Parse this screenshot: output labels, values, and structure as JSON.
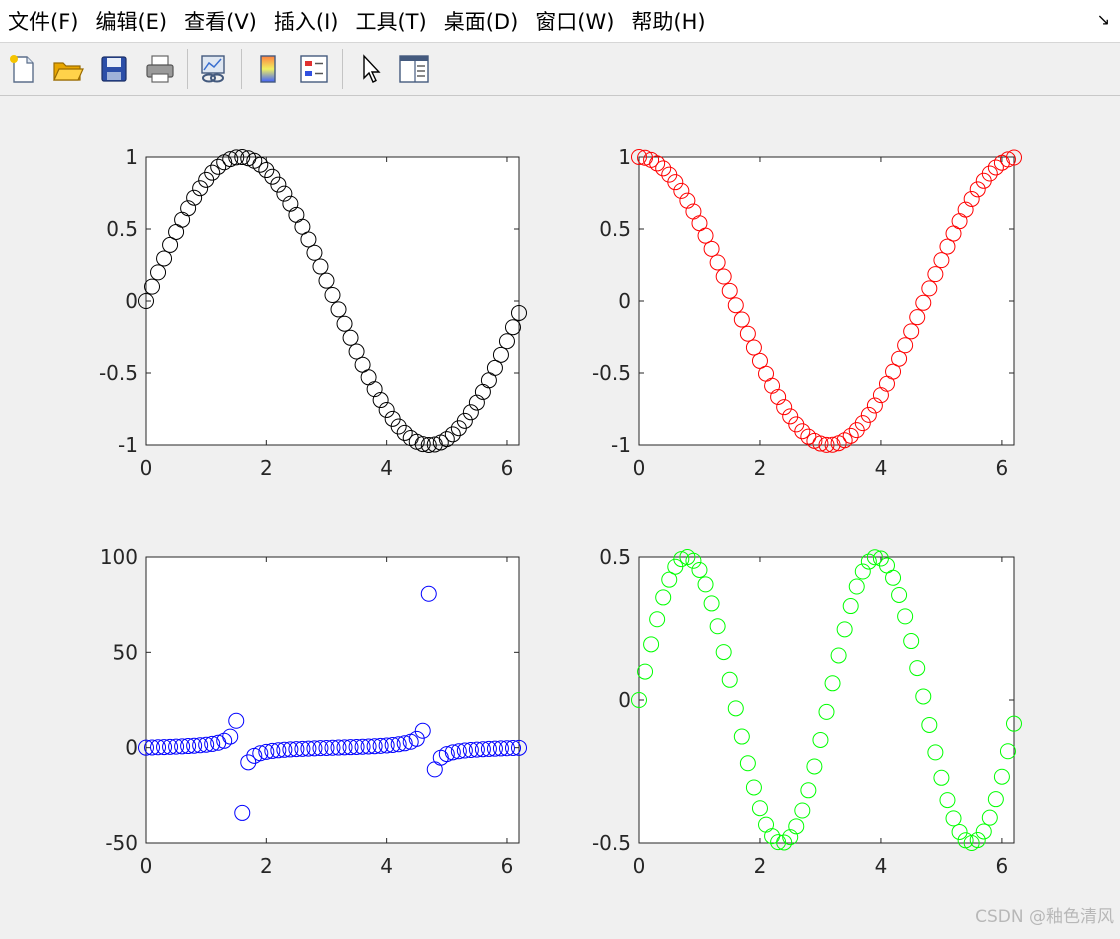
{
  "menu": {
    "items": [
      "文件(F)",
      "编辑(E)",
      "查看(V)",
      "插入(I)",
      "工具(T)",
      "桌面(D)",
      "窗口(W)",
      "帮助(H)"
    ],
    "corner_icon": "dock-arrow-icon"
  },
  "toolbar": {
    "buttons": [
      "new-file-icon",
      "open-folder-icon",
      "save-icon",
      "print-icon",
      "link-plot-icon",
      "colorbar-icon",
      "legend-icon",
      "pointer-icon",
      "property-editor-icon"
    ]
  },
  "watermark": "CSDN @釉色清风",
  "chart_data": [
    {
      "type": "scatter",
      "marker": "circle-open",
      "color": "#000000",
      "x": [
        0,
        0.1,
        0.2,
        0.3,
        0.4,
        0.5,
        0.6,
        0.7,
        0.8,
        0.9,
        1.0,
        1.1,
        1.2,
        1.3,
        1.4,
        1.5,
        1.6,
        1.7,
        1.8,
        1.9,
        2.0,
        2.1,
        2.2,
        2.3,
        2.4,
        2.5,
        2.6,
        2.7,
        2.8,
        2.9,
        3.0,
        3.1,
        3.2,
        3.3,
        3.4,
        3.5,
        3.6,
        3.7,
        3.8,
        3.9,
        4.0,
        4.1,
        4.2,
        4.3,
        4.4,
        4.5,
        4.6,
        4.7,
        4.8,
        4.9,
        5.0,
        5.1,
        5.2,
        5.3,
        5.4,
        5.5,
        5.6,
        5.7,
        5.8,
        5.9,
        6.0,
        6.1,
        6.2
      ],
      "y": [
        0,
        0.0998,
        0.1987,
        0.2955,
        0.3894,
        0.4794,
        0.5646,
        0.6442,
        0.7174,
        0.7833,
        0.8415,
        0.8912,
        0.932,
        0.9636,
        0.9854,
        0.9975,
        0.9996,
        0.9917,
        0.9738,
        0.9463,
        0.9093,
        0.8632,
        0.8085,
        0.7457,
        0.6755,
        0.5985,
        0.5155,
        0.4274,
        0.335,
        0.2392,
        0.1411,
        0.0416,
        -0.0584,
        -0.1577,
        -0.2555,
        -0.3508,
        -0.4425,
        -0.5298,
        -0.6119,
        -0.6878,
        -0.7568,
        -0.8183,
        -0.8716,
        -0.9162,
        -0.9516,
        -0.9775,
        -0.9937,
        -0.9999,
        -0.9962,
        -0.9825,
        -0.9589,
        -0.9258,
        -0.8835,
        -0.8323,
        -0.7728,
        -0.7055,
        -0.6313,
        -0.5507,
        -0.4646,
        -0.3739,
        -0.2794,
        -0.1822,
        -0.0831
      ],
      "xlim": [
        0,
        6.2
      ],
      "ylim": [
        -1,
        1
      ],
      "xticks": [
        0,
        2,
        4,
        6
      ],
      "yticks": [
        -1,
        -0.5,
        0,
        0.5,
        1
      ],
      "xtick_labels": [
        "0",
        "2",
        "4",
        "6"
      ],
      "ytick_labels": [
        "-1",
        "-0.5",
        "0",
        "0.5",
        "1"
      ]
    },
    {
      "type": "scatter",
      "marker": "circle-open",
      "color": "#ff0000",
      "x": [
        0,
        0.1,
        0.2,
        0.3,
        0.4,
        0.5,
        0.6,
        0.7,
        0.8,
        0.9,
        1.0,
        1.1,
        1.2,
        1.3,
        1.4,
        1.5,
        1.6,
        1.7,
        1.8,
        1.9,
        2.0,
        2.1,
        2.2,
        2.3,
        2.4,
        2.5,
        2.6,
        2.7,
        2.8,
        2.9,
        3.0,
        3.1,
        3.2,
        3.3,
        3.4,
        3.5,
        3.6,
        3.7,
        3.8,
        3.9,
        4.0,
        4.1,
        4.2,
        4.3,
        4.4,
        4.5,
        4.6,
        4.7,
        4.8,
        4.9,
        5.0,
        5.1,
        5.2,
        5.3,
        5.4,
        5.5,
        5.6,
        5.7,
        5.8,
        5.9,
        6.0,
        6.1,
        6.2
      ],
      "y": [
        1,
        0.995,
        0.9801,
        0.9553,
        0.9211,
        0.8776,
        0.8253,
        0.7648,
        0.6967,
        0.6216,
        0.5403,
        0.4536,
        0.3624,
        0.2675,
        0.17,
        0.0707,
        -0.0292,
        -0.1288,
        -0.2272,
        -0.3233,
        -0.4161,
        -0.5048,
        -0.5885,
        -0.6663,
        -0.7374,
        -0.8011,
        -0.8569,
        -0.9041,
        -0.9422,
        -0.971,
        -0.99,
        -0.9991,
        -0.9983,
        -0.9875,
        -0.9668,
        -0.9365,
        -0.8968,
        -0.8481,
        -0.791,
        -0.7259,
        -0.6536,
        -0.5748,
        -0.4903,
        -0.4008,
        -0.3073,
        -0.2108,
        -0.1122,
        -0.0124,
        0.0875,
        0.1865,
        0.2837,
        0.378,
        0.4685,
        0.5544,
        0.6347,
        0.7087,
        0.7756,
        0.8347,
        0.8855,
        0.9275,
        0.9602,
        0.9833,
        0.9965
      ],
      "xlim": [
        0,
        6.2
      ],
      "ylim": [
        -1,
        1
      ],
      "xticks": [
        0,
        2,
        4,
        6
      ],
      "yticks": [
        -1,
        -0.5,
        0,
        0.5,
        1
      ],
      "xtick_labels": [
        "0",
        "2",
        "4",
        "6"
      ],
      "ytick_labels": [
        "-1",
        "-0.5",
        "0",
        "0.5",
        "1"
      ]
    },
    {
      "type": "scatter",
      "marker": "circle-open",
      "color": "#0000ff",
      "x": [
        0,
        0.1,
        0.2,
        0.3,
        0.4,
        0.5,
        0.6,
        0.7,
        0.8,
        0.9,
        1.0,
        1.1,
        1.2,
        1.3,
        1.4,
        1.5,
        1.6,
        1.7,
        1.8,
        1.9,
        2.0,
        2.1,
        2.2,
        2.3,
        2.4,
        2.5,
        2.6,
        2.7,
        2.8,
        2.9,
        3.0,
        3.1,
        3.2,
        3.3,
        3.4,
        3.5,
        3.6,
        3.7,
        3.8,
        3.9,
        4.0,
        4.1,
        4.2,
        4.3,
        4.4,
        4.5,
        4.6,
        4.7,
        4.8,
        4.9,
        5.0,
        5.1,
        5.2,
        5.3,
        5.4,
        5.5,
        5.6,
        5.7,
        5.8,
        5.9,
        6.0,
        6.1,
        6.2
      ],
      "y": [
        0,
        0.1003,
        0.2027,
        0.3093,
        0.4228,
        0.5463,
        0.6841,
        0.8423,
        1.0296,
        1.2602,
        1.5574,
        1.9648,
        2.5722,
        3.6021,
        5.7979,
        14.1014,
        -34.2325,
        -7.6966,
        -4.2863,
        -2.927,
        -2.185,
        -1.7098,
        -1.3738,
        -1.1192,
        -0.916,
        -0.747,
        -0.6016,
        -0.4727,
        -0.3555,
        -0.2464,
        -0.1425,
        -0.0416,
        0.0585,
        0.1597,
        0.2643,
        0.3746,
        0.4935,
        0.6247,
        0.7736,
        0.9474,
        1.1578,
        1.4235,
        1.7777,
        2.2858,
        3.0963,
        4.6373,
        8.8602,
        80.7128,
        -11.3849,
        -5.2675,
        -3.3805,
        -2.4494,
        -1.8856,
        -1.5013,
        -1.2175,
        -0.9956,
        -0.8139,
        -0.6597,
        -0.5247,
        -0.4031,
        -0.291,
        -0.1853,
        -0.0834
      ],
      "xlim": [
        0,
        6.2
      ],
      "ylim": [
        -50,
        100
      ],
      "xticks": [
        0,
        2,
        4,
        6
      ],
      "yticks": [
        -50,
        0,
        50,
        100
      ],
      "xtick_labels": [
        "0",
        "2",
        "4",
        "6"
      ],
      "ytick_labels": [
        "-50",
        "0",
        "50",
        "100"
      ]
    },
    {
      "type": "scatter",
      "marker": "circle-open",
      "color": "#00ff00",
      "x": [
        0,
        0.1,
        0.2,
        0.3,
        0.4,
        0.5,
        0.6,
        0.7,
        0.8,
        0.9,
        1.0,
        1.1,
        1.2,
        1.3,
        1.4,
        1.5,
        1.6,
        1.7,
        1.8,
        1.9,
        2.0,
        2.1,
        2.2,
        2.3,
        2.4,
        2.5,
        2.6,
        2.7,
        2.8,
        2.9,
        3.0,
        3.1,
        3.2,
        3.3,
        3.4,
        3.5,
        3.6,
        3.7,
        3.8,
        3.9,
        4.0,
        4.1,
        4.2,
        4.3,
        4.4,
        4.5,
        4.6,
        4.7,
        4.8,
        4.9,
        5.0,
        5.1,
        5.2,
        5.3,
        5.4,
        5.5,
        5.6,
        5.7,
        5.8,
        5.9,
        6.0,
        6.1,
        6.2
      ],
      "y": [
        0,
        0.0993,
        0.1947,
        0.2823,
        0.3587,
        0.4207,
        0.466,
        0.4927,
        0.4998,
        0.4869,
        0.4546,
        0.4042,
        0.3377,
        0.2578,
        0.1675,
        0.0706,
        -0.0292,
        -0.1278,
        -0.2212,
        -0.3059,
        -0.3784,
        -0.4358,
        -0.4758,
        -0.4969,
        -0.4981,
        -0.4795,
        -0.4417,
        -0.3864,
        -0.3157,
        -0.2323,
        -0.1397,
        -0.0416,
        0.0584,
        0.1557,
        0.247,
        0.3285,
        0.3968,
        0.4493,
        0.484,
        0.4993,
        0.4947,
        0.4704,
        0.4273,
        0.3672,
        0.2924,
        0.2061,
        0.1115,
        0.0124,
        -0.0872,
        -0.1832,
        -0.272,
        -0.35,
        -0.4139,
        -0.4614,
        -0.4905,
        -0.5,
        -0.4897,
        -0.4597,
        -0.4114,
        -0.3468,
        -0.2683,
        -0.1792,
        -0.0828
      ],
      "xlim": [
        0,
        6.2
      ],
      "ylim": [
        -0.5,
        0.5
      ],
      "xticks": [
        0,
        2,
        4,
        6
      ],
      "yticks": [
        -0.5,
        0,
        0.5
      ],
      "xtick_labels": [
        "0",
        "2",
        "4",
        "6"
      ],
      "ytick_labels": [
        "-0.5",
        "0",
        "0.5"
      ]
    }
  ]
}
